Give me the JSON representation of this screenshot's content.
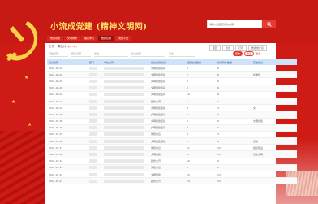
{
  "header": {
    "site_title": "小流成党建 (精神文明网)",
    "search_placeholder": "请输入您要查找的内容",
    "search_icon": "magnifier-icon"
  },
  "nav": {
    "items": [
      "党建动态",
      "文明城市",
      "理论学习",
      "数据查看",
      "党建平台"
    ],
    "active_index": 3
  },
  "page": {
    "title": "工作一周统计",
    "title_note": "(共75条)",
    "tools": [
      "返回",
      "导出",
      "打印",
      "数据统计表"
    ]
  },
  "filters": {
    "start_placeholder": "开始日期",
    "end_placeholder": "结束日期",
    "unit_placeholder": "单位",
    "type_placeholder": "信息类别",
    "status_placeholder": "状态",
    "query_label": "查询",
    "reset_label": "重置",
    "more_label": "更多"
  },
  "table": {
    "headers": [
      "提交日期",
      "部门",
      "单位名称",
      "信息类别/栏目",
      "党建信息数量",
      "新闻稿件数量",
      "其他信息"
    ],
    "rows": [
      {
        "date": "2021-08-05",
        "col4": "文明创建活动",
        "n1": "6",
        "n2": "6",
        "note": ""
      },
      {
        "date": "2021-08-05",
        "col4": "文明创建活动",
        "n1": "7",
        "n2": "6",
        "note": "标准化"
      },
      {
        "date": "2021-08-05",
        "col4": "文明创建活动",
        "n1": "6",
        "n2": "6",
        "note": ""
      },
      {
        "date": "2021-08-05",
        "col4": "文明创建活动",
        "n1": "6",
        "n2": "6",
        "note": ""
      },
      {
        "date": "2021-08-04",
        "col4": "文明创建活动",
        "n1": "10",
        "n2": "8",
        "note": ""
      },
      {
        "date": "2021-08-03",
        "col4": "政务公开",
        "n1": "1",
        "n2": "1",
        "note": ""
      },
      {
        "date": "2021-08-02",
        "col4": "文明创建活动",
        "n1": "3",
        "n2": "3",
        "note": "文"
      },
      {
        "date": "2021-07-30",
        "col4": "文明创建活动",
        "n1": "3",
        "n2": "3",
        "note": ""
      },
      {
        "date": "2021-07-30",
        "col4": "文明创建活动",
        "n1": "6",
        "n2": "6",
        "note": "文明创建"
      },
      {
        "date": "2021-07-29",
        "col4": "文明创建活动",
        "n1": "4",
        "n2": "4",
        "note": ""
      },
      {
        "date": "2021-07-29",
        "col4": "党建信息",
        "n1": "3",
        "n2": "3",
        "note": ""
      },
      {
        "date": "2021-07-28",
        "col4": "文明创建活动",
        "n1": "6",
        "n2": "6",
        "note": "党建"
      },
      {
        "date": "2021-07-27",
        "col4": "党建信息",
        "n1": "11",
        "n2": "10",
        "note": "组织建设"
      },
      {
        "date": "2021-07-26",
        "col4": "文明创建",
        "n1": "27",
        "n2": "23",
        "note": "创建文明"
      },
      {
        "date": "2021-07-24",
        "col4": "政务公开",
        "n1": "10",
        "n2": "9",
        "note": ""
      },
      {
        "date": "2021-07-23",
        "col4": "党建信息",
        "n1": "1",
        "n2": "1",
        "note": ""
      },
      {
        "date": "2021-07-22",
        "col4": "文明创建",
        "n1": "15",
        "n2": "13",
        "note": ""
      },
      {
        "date": "2021-07-21",
        "col4": "政务公开",
        "n1": "13",
        "n2": "13",
        "note": ""
      }
    ]
  }
}
